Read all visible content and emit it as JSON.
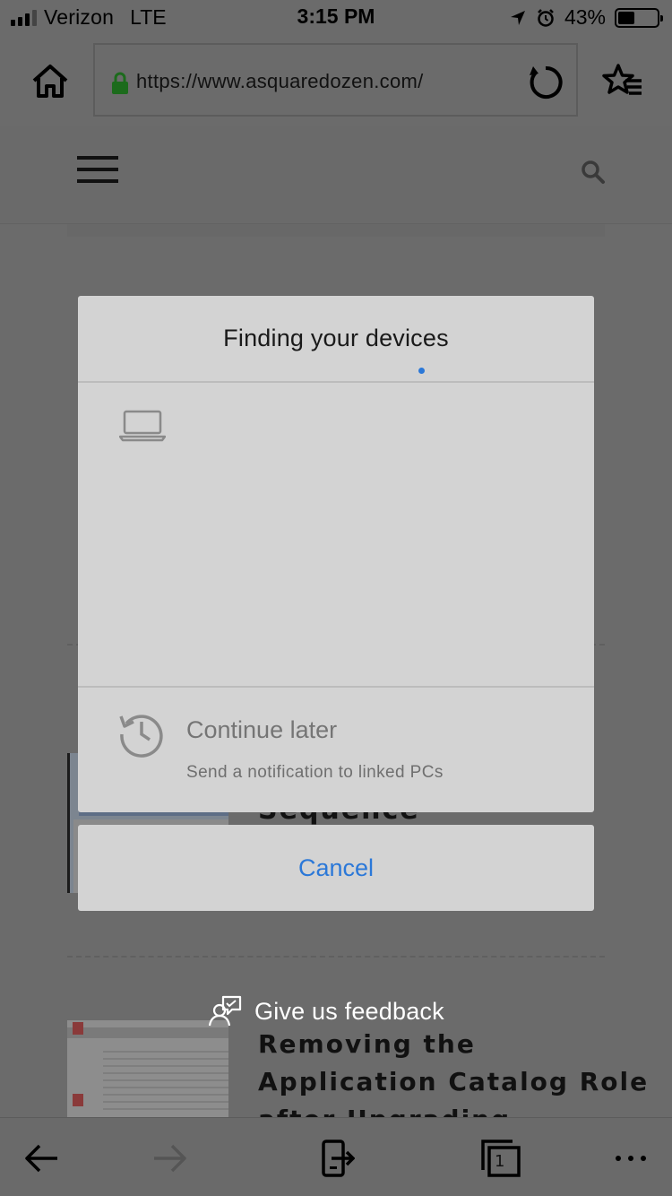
{
  "status_bar": {
    "carrier": "Verizon",
    "network": "LTE",
    "time": "3:15 PM",
    "battery_percent": "43%",
    "battery_level": 0.43
  },
  "browser": {
    "url": "https://www.asquaredozen.com/"
  },
  "page": {
    "article_titles": [
      "Sequence",
      "Removing the Application Catalog Role after Upgrading"
    ]
  },
  "dialog": {
    "title": "Finding your devices",
    "continue_later": {
      "title": "Continue later",
      "subtitle": "Send a notification to linked PCs"
    },
    "cancel_label": "Cancel"
  },
  "feedback": {
    "label": "Give us feedback"
  },
  "toolbar": {
    "tab_count": "1"
  },
  "colors": {
    "accent": "#2b78d8",
    "overlay": "#6b6b6b",
    "dialog_bg": "#d3d3d3"
  },
  "icons": [
    "home-icon",
    "lock-icon",
    "refresh-icon",
    "favorites-icon",
    "hamburger-icon",
    "search-icon",
    "laptop-icon",
    "history-icon",
    "feedback-icon",
    "back-icon",
    "forward-icon",
    "continue-on-pc-icon",
    "tabs-icon",
    "more-icon"
  ]
}
